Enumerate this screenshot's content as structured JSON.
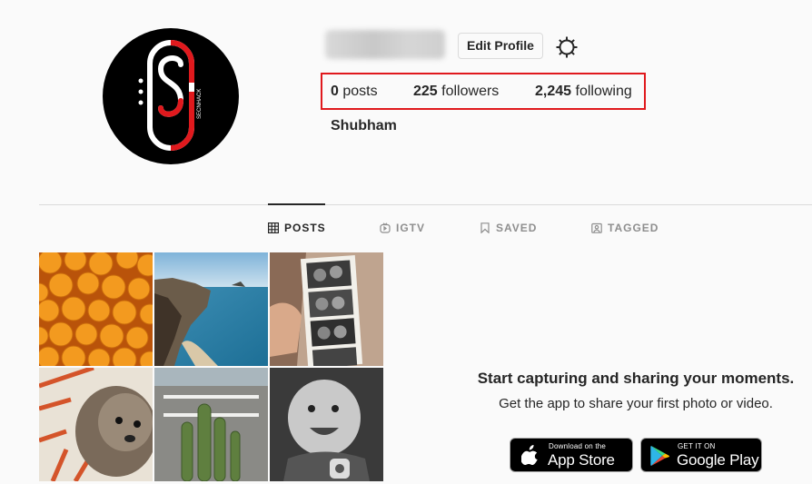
{
  "profile": {
    "edit_label": "Edit Profile",
    "full_name": "Shubham",
    "avatar_text": "SECNHACK"
  },
  "stats": {
    "posts_count": "0",
    "posts_label": "posts",
    "followers_count": "225",
    "followers_label": "followers",
    "following_count": "2,245",
    "following_label": "following"
  },
  "tabs": [
    {
      "label": "POSTS",
      "icon": "grid-icon"
    },
    {
      "label": "IGTV",
      "icon": "igtv-icon"
    },
    {
      "label": "SAVED",
      "icon": "bookmark-icon"
    },
    {
      "label": "TAGGED",
      "icon": "tag-icon"
    }
  ],
  "empty_state": {
    "title": "Start capturing and sharing your moments.",
    "subtitle": "Get the app to share your first photo or video."
  },
  "app_badges": {
    "apple_small": "Download on the",
    "apple_big": "App Store",
    "google_small": "GET IT ON",
    "google_big": "Google Play"
  },
  "colors": {
    "highlight": "#e0191d",
    "text": "#262626",
    "muted": "#8e8e8e"
  }
}
